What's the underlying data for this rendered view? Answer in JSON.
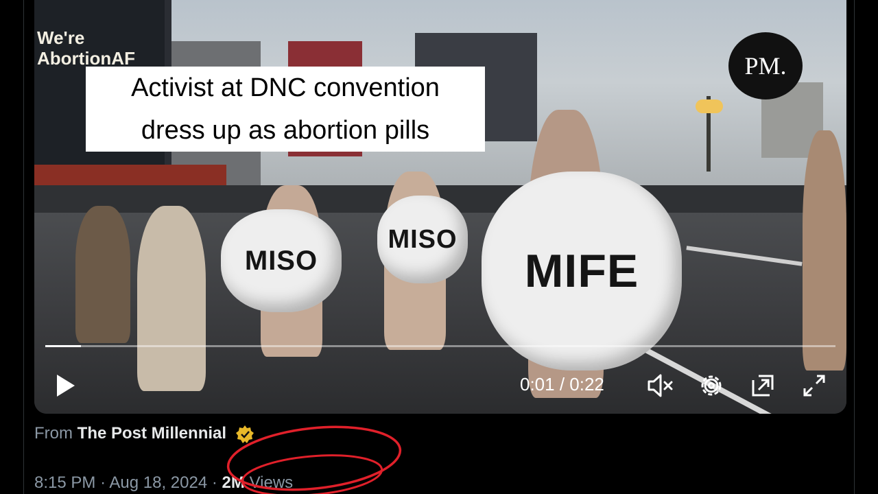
{
  "video": {
    "caption_line1": "Activist at DNC convention",
    "caption_line2": "dress up as abortion pills",
    "channel_logo_text": "PM.",
    "background_sign_text": "We're AbortionAF",
    "costumes": [
      "MISO",
      "MISO",
      "MIFE"
    ],
    "time_current": "0:01",
    "time_total": "0:22",
    "progress_fraction": 0.045,
    "controls": [
      "play-icon",
      "mute-icon",
      "settings-icon",
      "picture-in-picture-icon",
      "fullscreen-icon"
    ]
  },
  "tweet_meta": {
    "from_prefix": "From",
    "source_name": "The Post Millennial",
    "verified_badge_color": "#e8b829",
    "time": "8:15 PM",
    "date": "Aug 18, 2024",
    "separator": "·",
    "views_count": "2M",
    "views_label": "Views"
  },
  "annotation_color": "#e0202a"
}
